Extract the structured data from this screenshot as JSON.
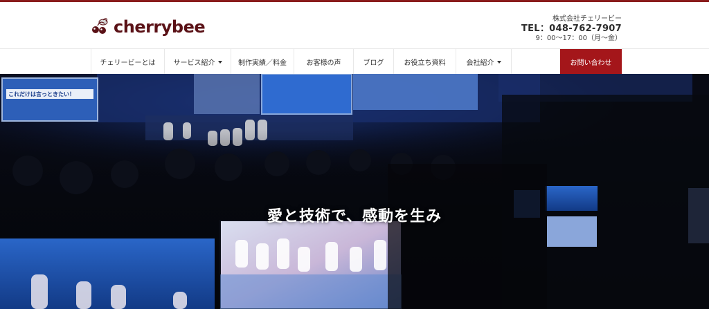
{
  "brand": {
    "name": "cherrybee",
    "accent_color": "#5a1116",
    "cta_color": "#a4161a"
  },
  "contact": {
    "company": "株式会社チェリービー",
    "tel": "TEL：048-762-7907",
    "hours": "9：00〜17：00（月〜金）"
  },
  "nav": {
    "items": [
      {
        "label": "チェリービーとは",
        "dropdown": false
      },
      {
        "label": "サービス紹介",
        "dropdown": true
      },
      {
        "label": "制作実績／料金",
        "dropdown": false
      },
      {
        "label": "お客様の声",
        "dropdown": false
      },
      {
        "label": "ブログ",
        "dropdown": false
      },
      {
        "label": "お役立ち資料",
        "dropdown": false
      },
      {
        "label": "会社紹介",
        "dropdown": true
      }
    ],
    "cta_label": "お問い合わせ"
  },
  "hero": {
    "tagline": "愛と技術で、感動を生み",
    "screen_caption": "これだけは言っときたい！"
  }
}
